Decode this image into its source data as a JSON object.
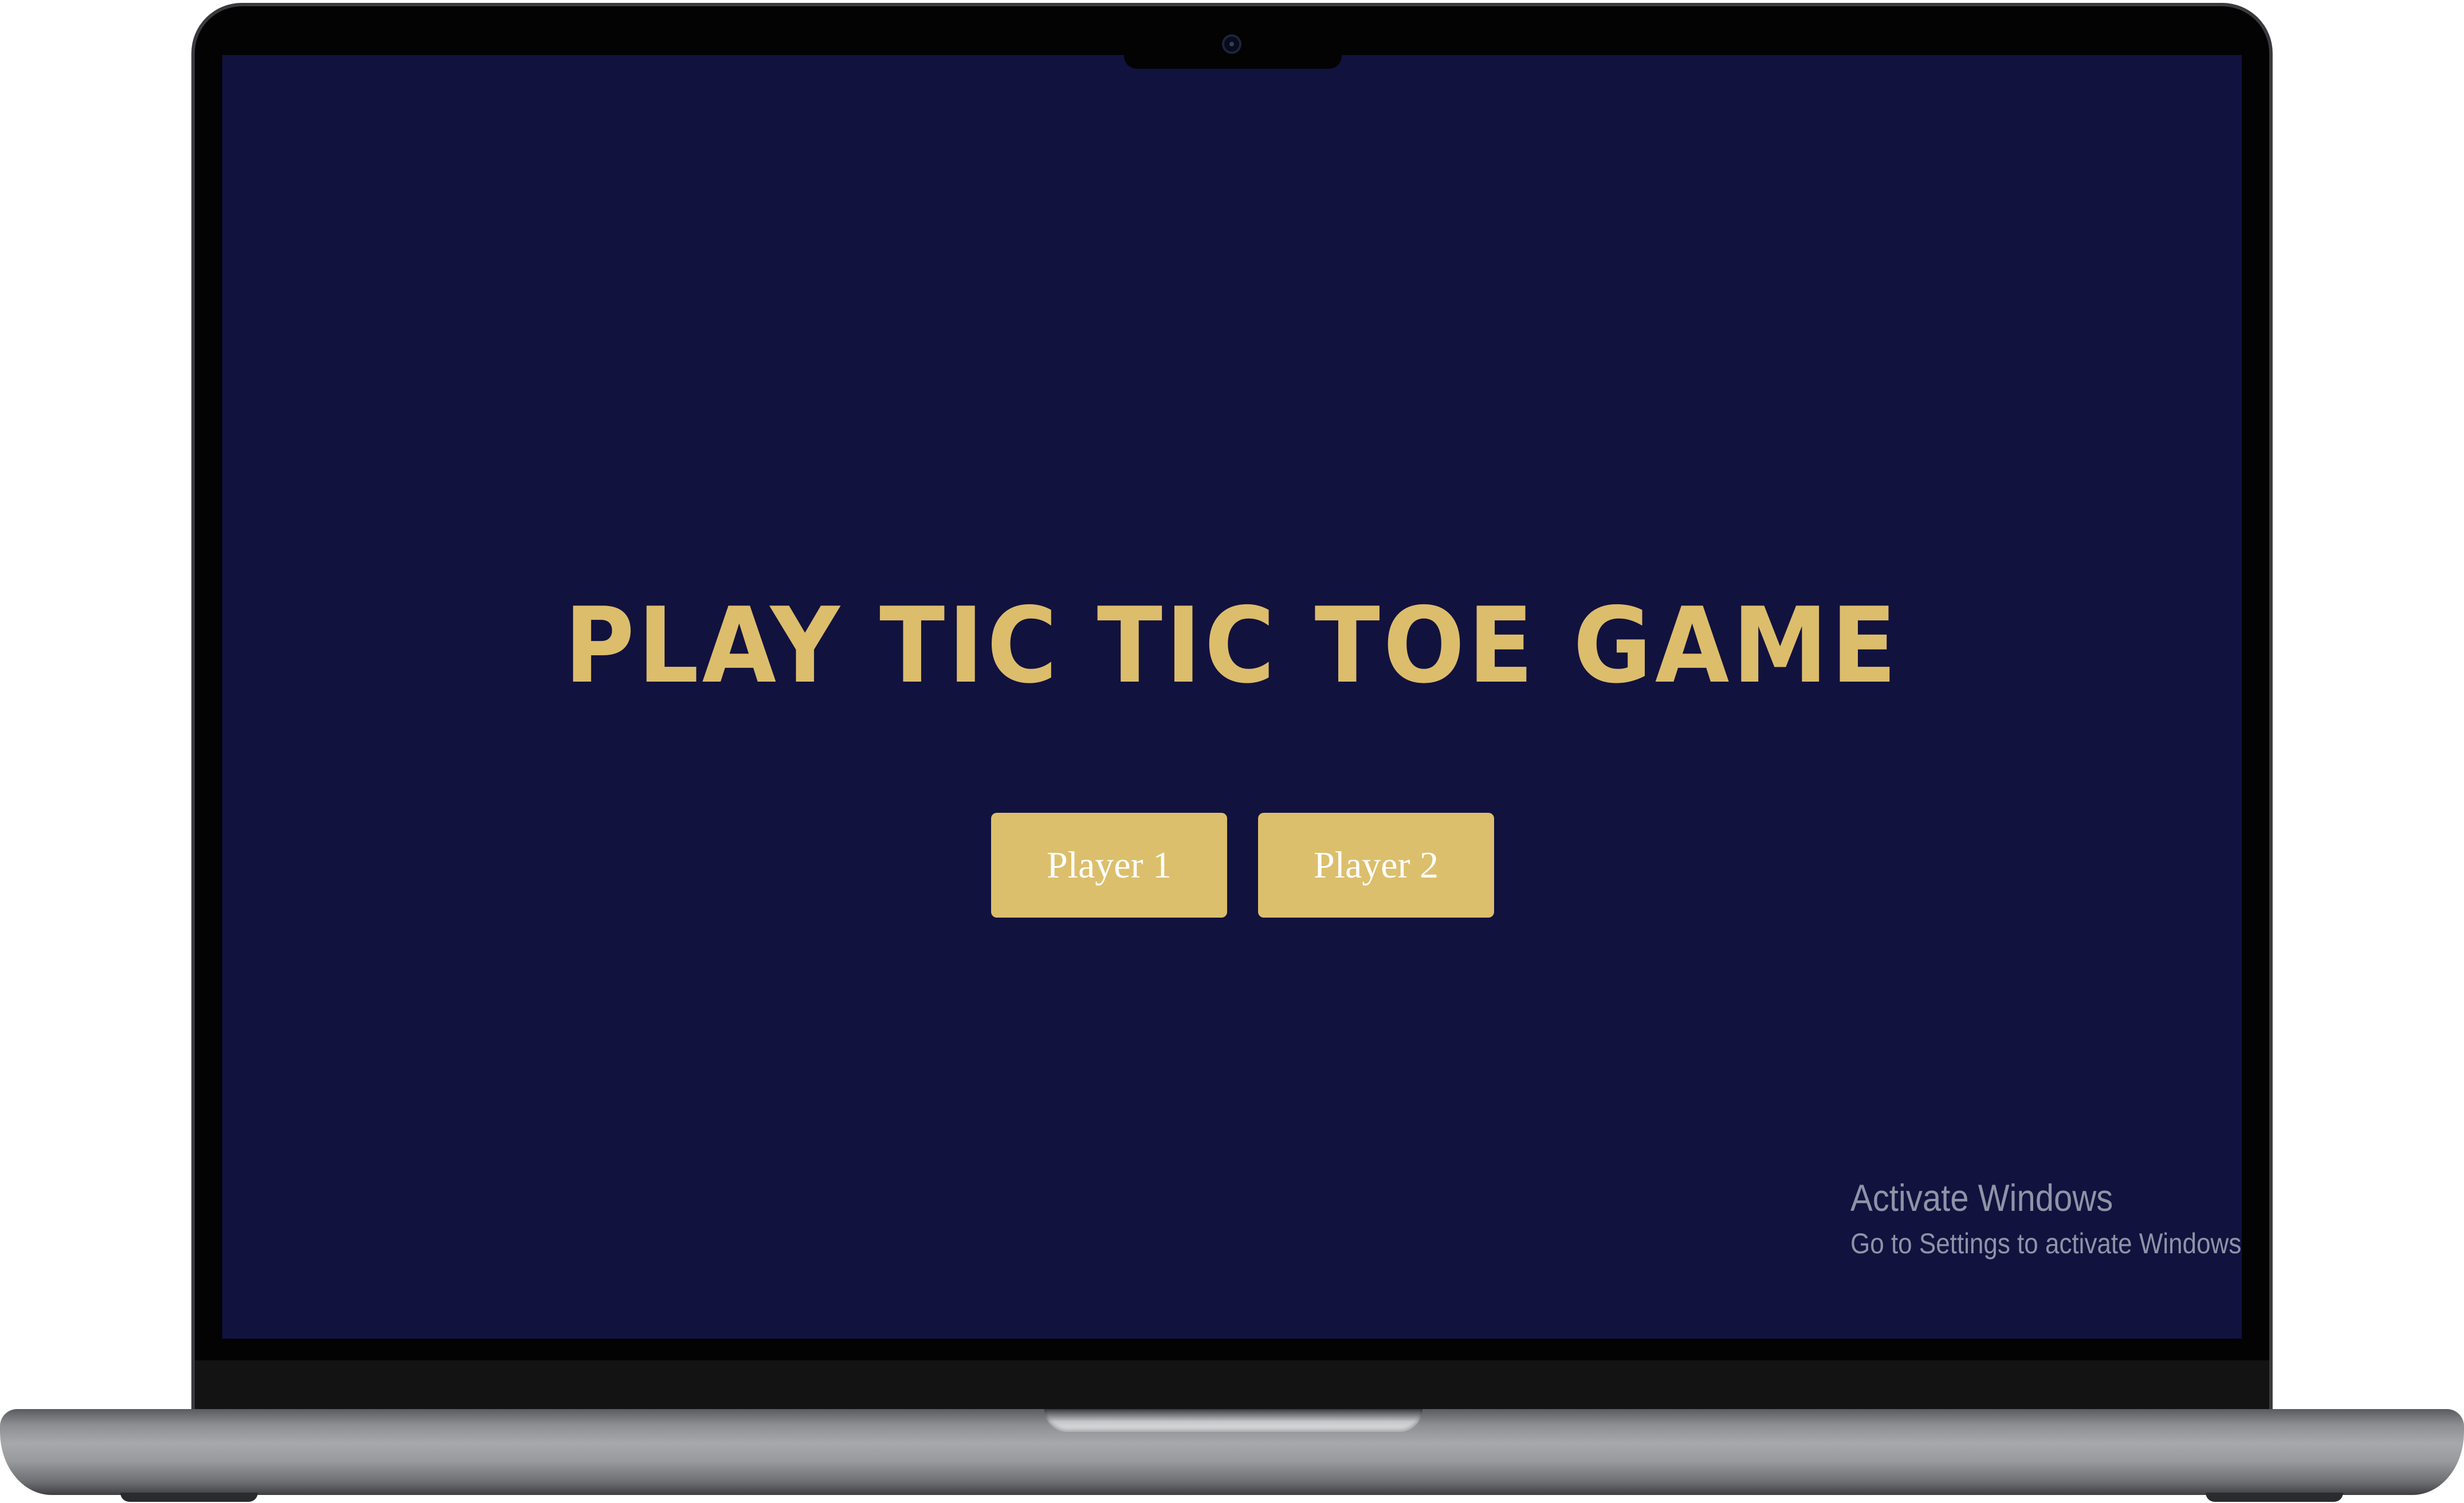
{
  "game": {
    "title": "PLAY TIC TIC TOE GAME",
    "buttons": [
      {
        "label": "Player 1"
      },
      {
        "label": "Player 2"
      }
    ]
  },
  "windows_watermark": {
    "title": "Activate Windows",
    "subtitle": "Go to Settings to activate Windows."
  },
  "colors": {
    "screen_background": "#12123f",
    "accent_gold": "#dcbd6c",
    "button_text": "#ffffff",
    "watermark_text": "#8f93a6"
  }
}
